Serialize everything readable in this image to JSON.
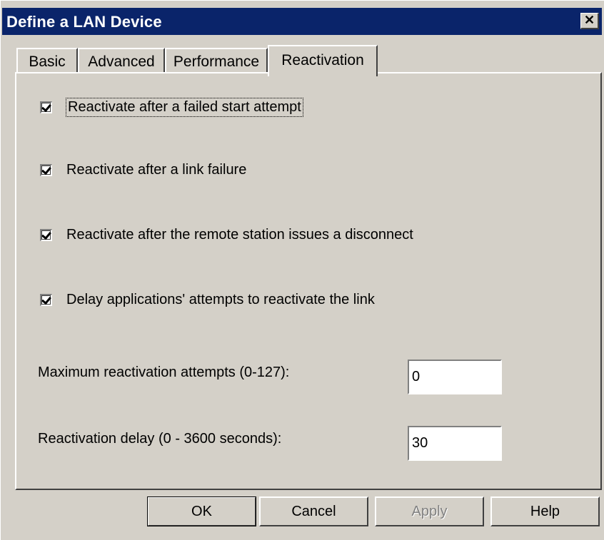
{
  "window": {
    "title": "Define a LAN Device",
    "close_label": "✕"
  },
  "tabs": [
    {
      "label": "Basic",
      "active": false
    },
    {
      "label": "Advanced",
      "active": false
    },
    {
      "label": "Performance",
      "active": false
    },
    {
      "label": "Reactivation",
      "active": true
    }
  ],
  "checkboxes": [
    {
      "label": "Reactivate after a failed start attempt",
      "checked": true,
      "focused": true
    },
    {
      "label": "Reactivate after a link failure",
      "checked": true
    },
    {
      "label": "Reactivate after the remote station issues a disconnect",
      "checked": true
    },
    {
      "label": "Delay applications' attempts to reactivate the link",
      "checked": true
    }
  ],
  "fields": {
    "max_attempts": {
      "label": "Maximum reactivation attempts (0-127):",
      "value": "0"
    },
    "delay": {
      "label": "Reactivation delay (0 - 3600 seconds):",
      "value": "30"
    }
  },
  "buttons": {
    "ok": "OK",
    "cancel": "Cancel",
    "apply": "Apply",
    "help": "Help"
  }
}
